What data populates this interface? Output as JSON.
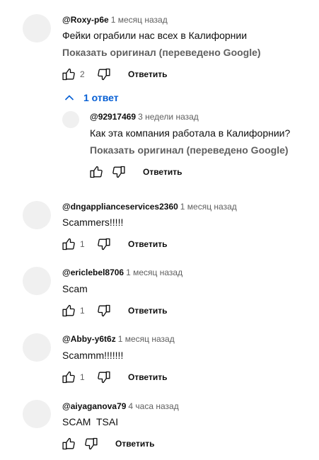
{
  "comments": [
    {
      "author": "@Roxy-p6e",
      "time": "1 месяц назад",
      "text": "Фейки ограбили нас всех в Калифорнии",
      "translate": "Показать оригинал (переведено Google)",
      "likes": "2",
      "reply_label": "Ответить"
    },
    {
      "author": "@dngapplianceservices2360",
      "time": "1 месяц назад",
      "text": "Scammers!!!!!",
      "likes": "1",
      "reply_label": "Ответить"
    },
    {
      "author": "@ericlebel8706",
      "time": "1 месяц назад",
      "text": "Scam",
      "likes": "1",
      "reply_label": "Ответить"
    },
    {
      "author": "@Abby-y6t6z",
      "time": "1 месяц назад",
      "text": "Scammm!!!!!!!",
      "likes": "1",
      "reply_label": "Ответить"
    },
    {
      "author": "@aiyaganova79",
      "time": "4 часа назад",
      "text": "SCAM  TSAI",
      "likes": "",
      "reply_label": "Ответить"
    }
  ],
  "replies_toggle": "1 ответ",
  "reply": {
    "author": "@92917469",
    "time": "3 недели назад",
    "text": "Как эта компания работала в Калифорнии?",
    "translate": "Показать оригинал (переведено Google)",
    "reply_label": "Ответить"
  },
  "colors": {
    "link": "#065fd4",
    "muted": "#606060",
    "avatar": "#f0f0f0"
  },
  "icons": [
    "like-icon",
    "dislike-icon",
    "chevron-up-icon"
  ]
}
